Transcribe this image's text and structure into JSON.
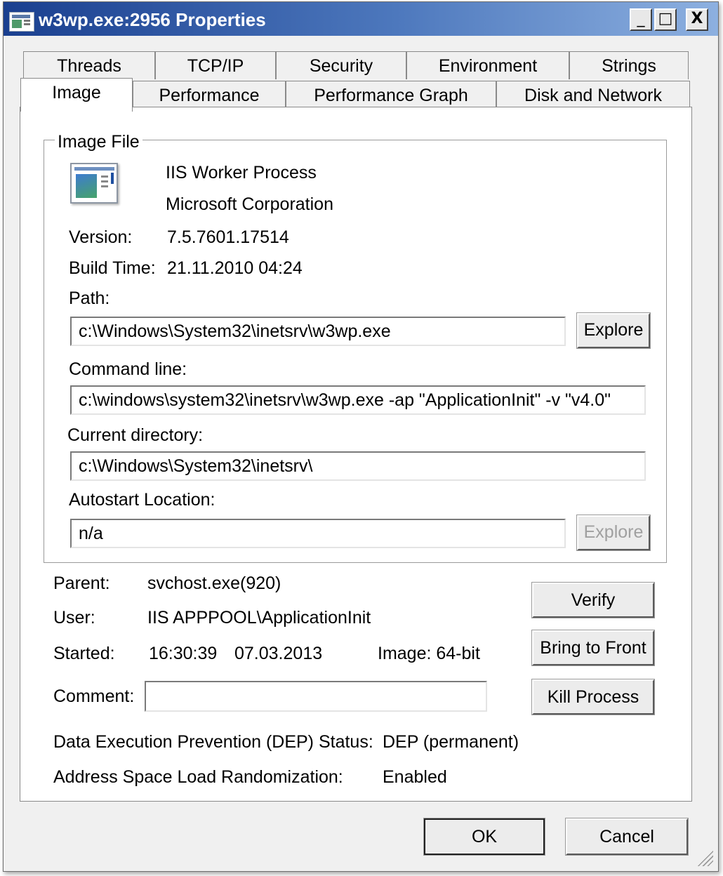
{
  "window": {
    "title": "w3wp.exe:2956 Properties",
    "controls": {
      "minimize": "_",
      "maximize": "□",
      "close": "X"
    }
  },
  "tabs": {
    "row1": [
      "Threads",
      "TCP/IP",
      "Security",
      "Environment",
      "Strings"
    ],
    "row2": [
      "Image",
      "Performance",
      "Performance Graph",
      "Disk and Network"
    ],
    "active": "Image"
  },
  "image_file": {
    "legend": "Image File",
    "description": "IIS Worker Process",
    "company": "Microsoft Corporation",
    "version_label": "Version:",
    "version": "7.5.7601.17514",
    "build_time_label": "Build Time:",
    "build_time": "21.11.2010 04:24",
    "path_label": "Path:",
    "path": "c:\\Windows\\System32\\inetsrv\\w3wp.exe",
    "explore_label": "Explore",
    "command_line_label": "Command line:",
    "command_line": "c:\\windows\\system32\\inetsrv\\w3wp.exe -ap \"ApplicationInit\" -v \"v4.0\"",
    "current_directory_label": "Current directory:",
    "current_directory": "c:\\Windows\\System32\\inetsrv\\",
    "autostart_label": "Autostart Location:",
    "autostart": "n/a",
    "autostart_explore_label": "Explore"
  },
  "details": {
    "parent_label": "Parent:",
    "parent": "svchost.exe(920)",
    "user_label": "User:",
    "user": "IIS APPPOOL\\ApplicationInit",
    "started_label": "Started:",
    "started_time": "16:30:39",
    "started_date": "07.03.2013",
    "image_bits": "Image: 64-bit",
    "comment_label": "Comment:",
    "comment": "",
    "dep_label": "Data Execution Prevention (DEP) Status:",
    "dep_value": "DEP (permanent)",
    "aslr_label": "Address Space Load Randomization:",
    "aslr_value": "Enabled"
  },
  "actions": {
    "verify": "Verify",
    "bring_to_front": "Bring to Front",
    "kill_process": "Kill Process"
  },
  "footer": {
    "ok": "OK",
    "cancel": "Cancel"
  }
}
